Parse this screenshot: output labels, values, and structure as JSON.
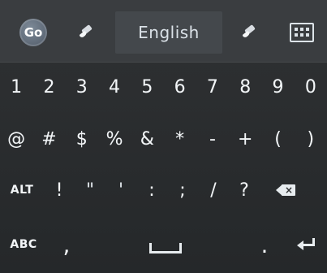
{
  "toolbar": {
    "go_logo_text": "Go",
    "language_label": "English",
    "left_brush_icon": "brush-icon",
    "right_brush_icon": "brush-icon",
    "keyboard_icon": "keyboard-icon"
  },
  "keys": {
    "row1": [
      "1",
      "2",
      "3",
      "4",
      "5",
      "6",
      "7",
      "8",
      "9",
      "0"
    ],
    "row2": [
      "@",
      "#",
      "$",
      "%",
      "&",
      "*",
      "-",
      "+",
      "(",
      ")"
    ],
    "row3": {
      "alt_label": "ALT",
      "symbols": [
        "!",
        "\"",
        "'",
        ":",
        ";",
        "/",
        "?"
      ],
      "backspace_icon": "backspace-icon"
    },
    "row4": {
      "abc_label": "ABC",
      "comma": ",",
      "space_icon": "space-icon",
      "period": ".",
      "enter_icon": "enter-icon"
    }
  },
  "colors": {
    "background": "#2f3133",
    "toolbar": "#3a3d40",
    "language_chip": "#44484c",
    "key_text": "#f2f5f7"
  }
}
